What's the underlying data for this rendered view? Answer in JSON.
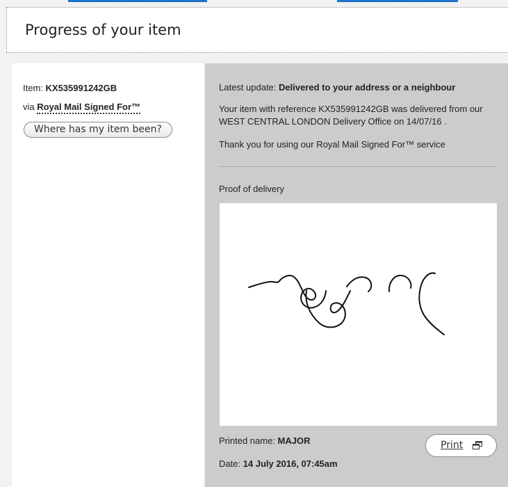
{
  "header": {
    "title": "Progress of your item"
  },
  "item": {
    "label": "Item: ",
    "reference": "KX535991242GB",
    "via_label": "via ",
    "service": "Royal Mail Signed For™",
    "where_button": "Where has my item been?"
  },
  "update": {
    "latest_label": "Latest update: ",
    "latest_value": "Delivered to your address or a neighbour",
    "description": "Your item with reference KX535991242GB was delivered from our WEST CENTRAL LONDON Delivery Office on 14/07/16 .",
    "thanks": "Thank you for using our Royal Mail Signed For™ service"
  },
  "proof": {
    "label": "Proof of delivery",
    "printed_label": "Printed name: ",
    "printed_value": "MAJOR",
    "date_label": "Date: ",
    "date_value": "14 July 2016, 07:45am",
    "print_button": "Print"
  },
  "icons": {
    "print": "popout-window-icon"
  },
  "colors": {
    "link_bar": "#1a73c7",
    "right_panel_bg": "#cccccc",
    "page_bg": "#f2f2f2"
  }
}
